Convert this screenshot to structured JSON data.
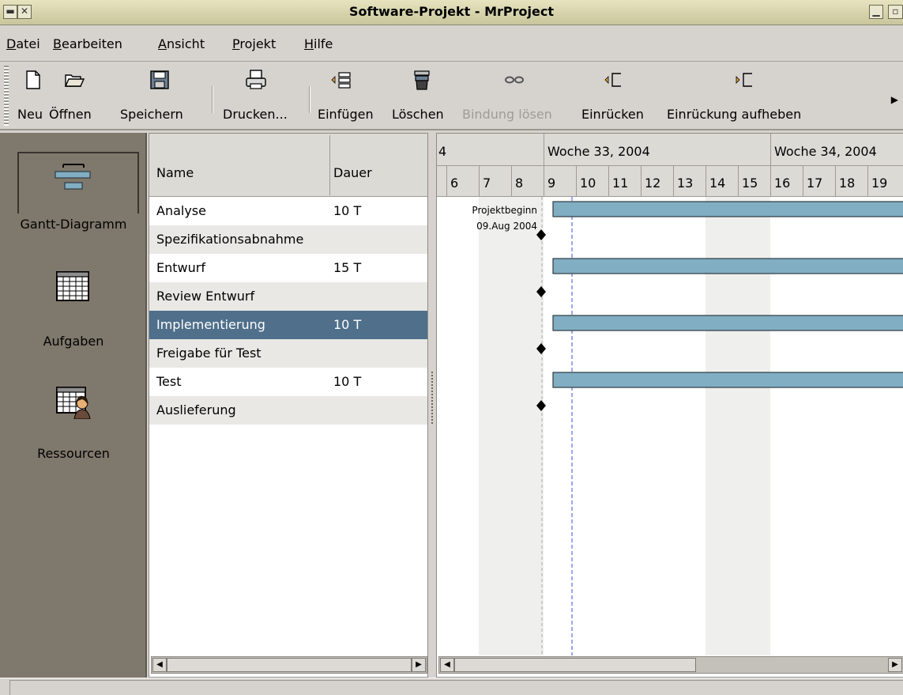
{
  "window": {
    "title": "Software-Projekt - MrProject"
  },
  "menu": [
    {
      "id": "datei",
      "first": "D",
      "rest": "atei"
    },
    {
      "id": "bearbeiten",
      "first": "B",
      "rest": "earbeiten"
    },
    {
      "id": "ansicht",
      "first": "A",
      "rest": "nsicht"
    },
    {
      "id": "projekt",
      "first": "P",
      "rest": "rojekt"
    },
    {
      "id": "hilfe",
      "first": "H",
      "rest": "ilfe"
    }
  ],
  "toolbar": {
    "new_label": "Neu",
    "open_label": "Öffnen",
    "save_label": "Speichern",
    "print_label": "Drucken...",
    "insert_label": "Einfügen",
    "delete_label": "Löschen",
    "unlink_label": "Bindung lösen",
    "indent_label": "Einrücken",
    "unindent_label": "Einrückung aufheben"
  },
  "sidebar": {
    "gantt_label": "Gantt-Diagramm",
    "tasks_label": "Aufgaben",
    "resources_label": "Ressourcen"
  },
  "tasklist": {
    "col_name": "Name",
    "col_duration": "Dauer",
    "rows": [
      {
        "name": "Analyse",
        "duration": "10 T"
      },
      {
        "name": "Spezifikationsabnahme",
        "duration": ""
      },
      {
        "name": "Entwurf",
        "duration": "15 T"
      },
      {
        "name": "Review Entwurf",
        "duration": ""
      },
      {
        "name": "Implementierung",
        "duration": "10 T",
        "selected": true
      },
      {
        "name": "Freigabe für Test",
        "duration": ""
      },
      {
        "name": "Test",
        "duration": "10 T"
      },
      {
        "name": "Auslieferung",
        "duration": ""
      }
    ]
  },
  "gantt": {
    "prev_week_fragment": "4",
    "weeks": [
      "Woche 33, 2004",
      "Woche 34, 2004"
    ],
    "days": [
      "6",
      "7",
      "8",
      "9",
      "10",
      "11",
      "12",
      "13",
      "14",
      "15",
      "16",
      "17",
      "18",
      "19"
    ],
    "weekend_days": [
      "7",
      "8",
      "14",
      "15"
    ],
    "project_start_label": "Projektbeginn",
    "project_start_date": "09.Aug 2004",
    "rows": [
      {
        "kind": "bar",
        "start_day": "9"
      },
      {
        "kind": "milestone",
        "day": "9"
      },
      {
        "kind": "bar",
        "start_day": "9"
      },
      {
        "kind": "milestone",
        "day": "9"
      },
      {
        "kind": "bar",
        "start_day": "9"
      },
      {
        "kind": "milestone",
        "day": "9"
      },
      {
        "kind": "bar",
        "start_day": "9"
      },
      {
        "kind": "milestone",
        "day": "9"
      }
    ],
    "colors": {
      "bar": "#81aec2",
      "bar_border": "#2e3a40",
      "today_line": "#3a4fe0",
      "weekend": "#efefed",
      "selected_row": "#4f6f8b"
    }
  }
}
